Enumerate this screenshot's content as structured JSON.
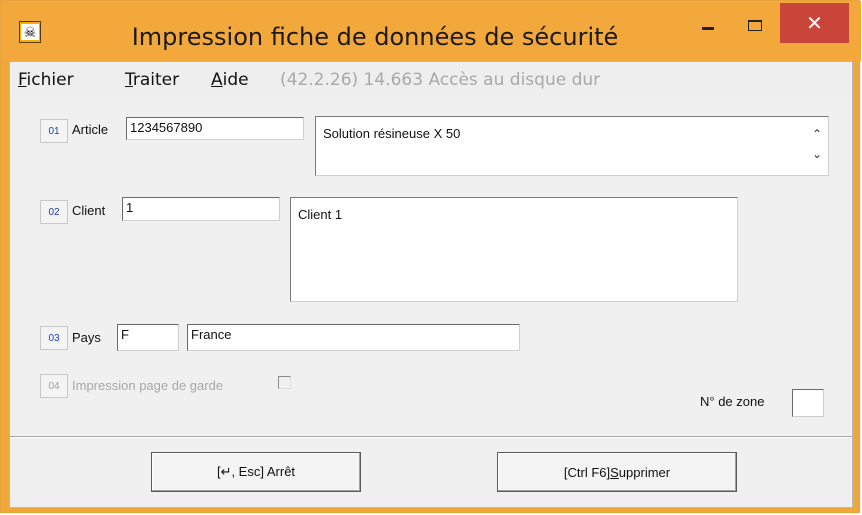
{
  "window": {
    "title": "Impression fiche de données de sécurité",
    "icon": "hazard-skull-icon",
    "controls": {
      "minimize": "minimize-icon",
      "maximize": "maximize-icon",
      "close": "✕"
    }
  },
  "menubar": {
    "items": [
      {
        "label_u": "F",
        "label_rest": "ichier"
      },
      {
        "label_u": "T",
        "label_rest": "raiter"
      },
      {
        "label_u": "A",
        "label_rest": "ide"
      }
    ],
    "status": "(42.2.26) 14.663 Accès au disque dur"
  },
  "form": {
    "article": {
      "num": "01",
      "label": "Article",
      "value": "1234567890",
      "description": "Solution résineuse X 50",
      "scroll_up": "⌃",
      "scroll_down": "⌄"
    },
    "client": {
      "num": "02",
      "label": "Client",
      "value": "1",
      "description": "Client 1"
    },
    "pays": {
      "num": "03",
      "label": "Pays",
      "code": "F",
      "name": "France"
    },
    "page_garde": {
      "num": "04",
      "label": "Impression page de garde",
      "checked": false
    },
    "zone": {
      "label": "N° de zone",
      "value": ""
    }
  },
  "actions": {
    "stop": {
      "label": "[↵, Esc] Arrêt"
    },
    "delete": {
      "label_prefix": "[Ctrl F6] ",
      "label_u": "S",
      "label_rest": "upprimer"
    }
  },
  "colors": {
    "titlebar": "#f3a83b",
    "close": "#c9453a",
    "num_text": "#1b3fa8",
    "disabled_text": "#a8a8a8"
  }
}
